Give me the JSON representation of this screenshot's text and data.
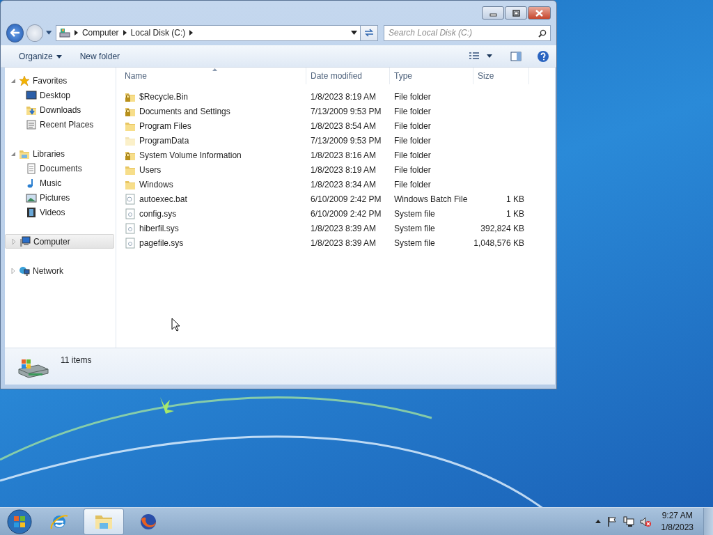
{
  "window": {
    "buttons": [
      {
        "kind": "minimize"
      },
      {
        "kind": "maximize"
      },
      {
        "kind": "close"
      }
    ]
  },
  "address_bar": {
    "crumbs": [
      "Computer",
      "Local Disk (C:)"
    ]
  },
  "search": {
    "placeholder": "Search Local Disk (C:)"
  },
  "toolbar": [
    {
      "label": "Organize",
      "kind": "menu"
    },
    {
      "label": "New folder",
      "kind": "button"
    }
  ],
  "nav": [
    {
      "label": "Favorites",
      "kind": "star",
      "expanded": true,
      "selected": false,
      "children": [
        {
          "label": "Desktop",
          "kind": "desktop"
        },
        {
          "label": "Downloads",
          "kind": "downloads"
        },
        {
          "label": "Recent Places",
          "kind": "recent"
        }
      ]
    },
    {
      "label": "Libraries",
      "kind": "library",
      "expanded": true,
      "selected": false,
      "children": [
        {
          "label": "Documents",
          "kind": "document"
        },
        {
          "label": "Music",
          "kind": "music"
        },
        {
          "label": "Pictures",
          "kind": "picture"
        },
        {
          "label": "Videos",
          "kind": "video"
        }
      ]
    },
    {
      "label": "Computer",
      "kind": "computer",
      "expanded": false,
      "selected": true
    },
    {
      "label": "Network",
      "kind": "network",
      "expanded": false,
      "selected": false
    }
  ],
  "table": {
    "columns": [
      "Name",
      "Date modified",
      "Type",
      "Size"
    ],
    "rows": [
      {
        "name": "$Recycle.Bin",
        "date": "1/8/2023 8:19 AM",
        "type": "File folder",
        "size": "",
        "kind": "locked-folder",
        "hidden": false
      },
      {
        "name": "Documents and Settings",
        "date": "7/13/2009 9:53 PM",
        "type": "File folder",
        "size": "",
        "kind": "locked-folder",
        "hidden": false
      },
      {
        "name": "Program Files",
        "date": "1/8/2023 8:54 AM",
        "type": "File folder",
        "size": "",
        "kind": "folder",
        "hidden": false
      },
      {
        "name": "ProgramData",
        "date": "7/13/2009 9:53 PM",
        "type": "File folder",
        "size": "",
        "kind": "folder",
        "hidden": true
      },
      {
        "name": "System Volume Information",
        "date": "1/8/2023 8:16 AM",
        "type": "File folder",
        "size": "",
        "kind": "locked-folder",
        "hidden": false
      },
      {
        "name": "Users",
        "date": "1/8/2023 8:19 AM",
        "type": "File folder",
        "size": "",
        "kind": "folder",
        "hidden": false
      },
      {
        "name": "Windows",
        "date": "1/8/2023 8:34 AM",
        "type": "File folder",
        "size": "",
        "kind": "folder",
        "hidden": false
      },
      {
        "name": "autoexec.bat",
        "date": "6/10/2009 2:42 PM",
        "type": "Windows Batch File",
        "size": "1 KB",
        "kind": "batch",
        "hidden": false
      },
      {
        "name": "config.sys",
        "date": "6/10/2009 2:42 PM",
        "type": "System file",
        "size": "1 KB",
        "kind": "file",
        "hidden": false
      },
      {
        "name": "hiberfil.sys",
        "date": "1/8/2023 8:39 AM",
        "type": "System file",
        "size": "392,824 KB",
        "kind": "file",
        "hidden": false
      },
      {
        "name": "pagefile.sys",
        "date": "1/8/2023 8:39 AM",
        "type": "System file",
        "size": "1,048,576 KB",
        "kind": "file",
        "hidden": false
      }
    ]
  },
  "status_bar": {
    "text": "11 items"
  },
  "taskbar": {
    "apps": [
      {
        "kind": "browser-e",
        "selected": false
      },
      {
        "kind": "explorer",
        "selected": true
      },
      {
        "kind": "browser-fox",
        "selected": false
      }
    ],
    "tray": [
      {
        "kind": "flag"
      },
      {
        "kind": "network"
      },
      {
        "kind": "speaker-muted"
      }
    ],
    "time": "9:27 AM",
    "date": "1/8/2023"
  }
}
